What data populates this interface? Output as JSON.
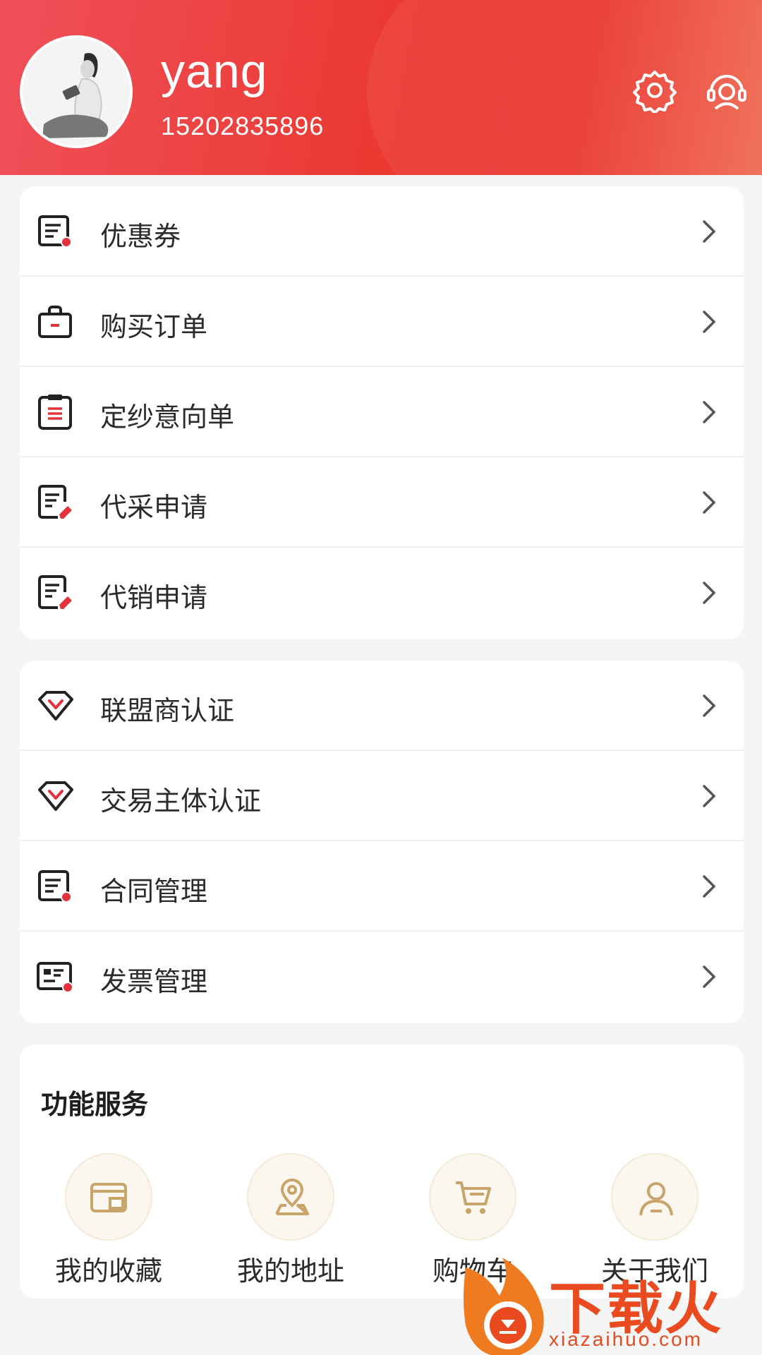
{
  "header": {
    "username": "yang",
    "phone": "15202835896",
    "icons": {
      "settings": "settings-gear-icon",
      "service": "customer-service-icon"
    }
  },
  "colors": {
    "brand_red": "#ea3a32",
    "icon_red": "#e2333c",
    "gold": "#c9a46a",
    "row_text": "#2b2b2b"
  },
  "menu_group_1": [
    {
      "label": "优惠券",
      "icon": "coupon-icon"
    },
    {
      "label": "购买订单",
      "icon": "shopping-bag-icon"
    },
    {
      "label": "定纱意向单",
      "icon": "clipboard-icon"
    },
    {
      "label": "代采申请",
      "icon": "document-edit-icon"
    },
    {
      "label": "代销申请",
      "icon": "document-edit-icon"
    }
  ],
  "menu_group_2": [
    {
      "label": "联盟商认证",
      "icon": "diamond-icon"
    },
    {
      "label": "交易主体认证",
      "icon": "diamond-icon"
    },
    {
      "label": "合同管理",
      "icon": "contract-icon"
    },
    {
      "label": "发票管理",
      "icon": "invoice-icon"
    }
  ],
  "services": {
    "title": "功能服务",
    "items": [
      {
        "label": "我的收藏",
        "icon": "favorites-card-icon"
      },
      {
        "label": "我的地址",
        "icon": "location-pin-icon"
      },
      {
        "label": "购物车",
        "icon": "shopping-cart-icon"
      },
      {
        "label": "关于我们",
        "icon": "user-profile-icon"
      }
    ]
  },
  "watermark": {
    "brand": "下载火",
    "url": "xiazaihuo.com"
  }
}
